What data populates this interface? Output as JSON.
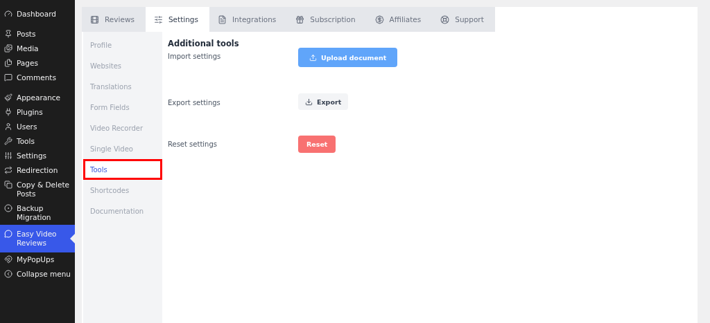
{
  "admin_menu": {
    "groups": [
      {
        "items": [
          {
            "label": "Dashboard",
            "selected": false
          }
        ]
      },
      {
        "items": [
          {
            "label": "Posts",
            "selected": false
          },
          {
            "label": "Media",
            "selected": false
          },
          {
            "label": "Pages",
            "selected": false
          },
          {
            "label": "Comments",
            "selected": false
          }
        ]
      },
      {
        "items": [
          {
            "label": "Appearance",
            "selected": false
          },
          {
            "label": "Plugins",
            "selected": false
          },
          {
            "label": "Users",
            "selected": false
          },
          {
            "label": "Tools",
            "selected": false
          },
          {
            "label": "Settings",
            "selected": false
          },
          {
            "label": "Redirection",
            "selected": false
          },
          {
            "label": "Copy & Delete Posts",
            "selected": false
          },
          {
            "label": "Backup Migration",
            "selected": false
          },
          {
            "label": "Easy Video Reviews",
            "selected": true
          },
          {
            "label": "MyPopUps",
            "selected": false
          },
          {
            "label": "Collapse menu",
            "selected": false
          }
        ]
      }
    ]
  },
  "tabs": [
    {
      "label": "Reviews",
      "selected": false
    },
    {
      "label": "Settings",
      "selected": true
    },
    {
      "label": "Integrations",
      "selected": false
    },
    {
      "label": "Subscription",
      "selected": false
    },
    {
      "label": "Affiliates",
      "selected": false
    },
    {
      "label": "Support",
      "selected": false
    }
  ],
  "settings_menu": [
    {
      "label": "Profile",
      "selected": false,
      "highlighted": false
    },
    {
      "label": "Websites",
      "selected": false,
      "highlighted": false
    },
    {
      "label": "Translations",
      "selected": false,
      "highlighted": false
    },
    {
      "label": "Form Fields",
      "selected": false,
      "highlighted": false
    },
    {
      "label": "Video Recorder",
      "selected": false,
      "highlighted": false
    },
    {
      "label": "Single Video",
      "selected": false,
      "highlighted": false
    },
    {
      "label": "Tools",
      "selected": true,
      "highlighted": true
    },
    {
      "label": "Shortcodes",
      "selected": false,
      "highlighted": false
    },
    {
      "label": "Documentation",
      "selected": false,
      "highlighted": false
    }
  ],
  "panel": {
    "title": "Additional tools",
    "rows": [
      {
        "label": "Import settings",
        "button": {
          "label": "Upload document",
          "kind": "upload"
        }
      },
      {
        "label": "Export settings",
        "button": {
          "label": "Export",
          "kind": "export"
        }
      },
      {
        "label": "Reset settings",
        "button": {
          "label": "Reset",
          "kind": "reset"
        }
      }
    ]
  }
}
